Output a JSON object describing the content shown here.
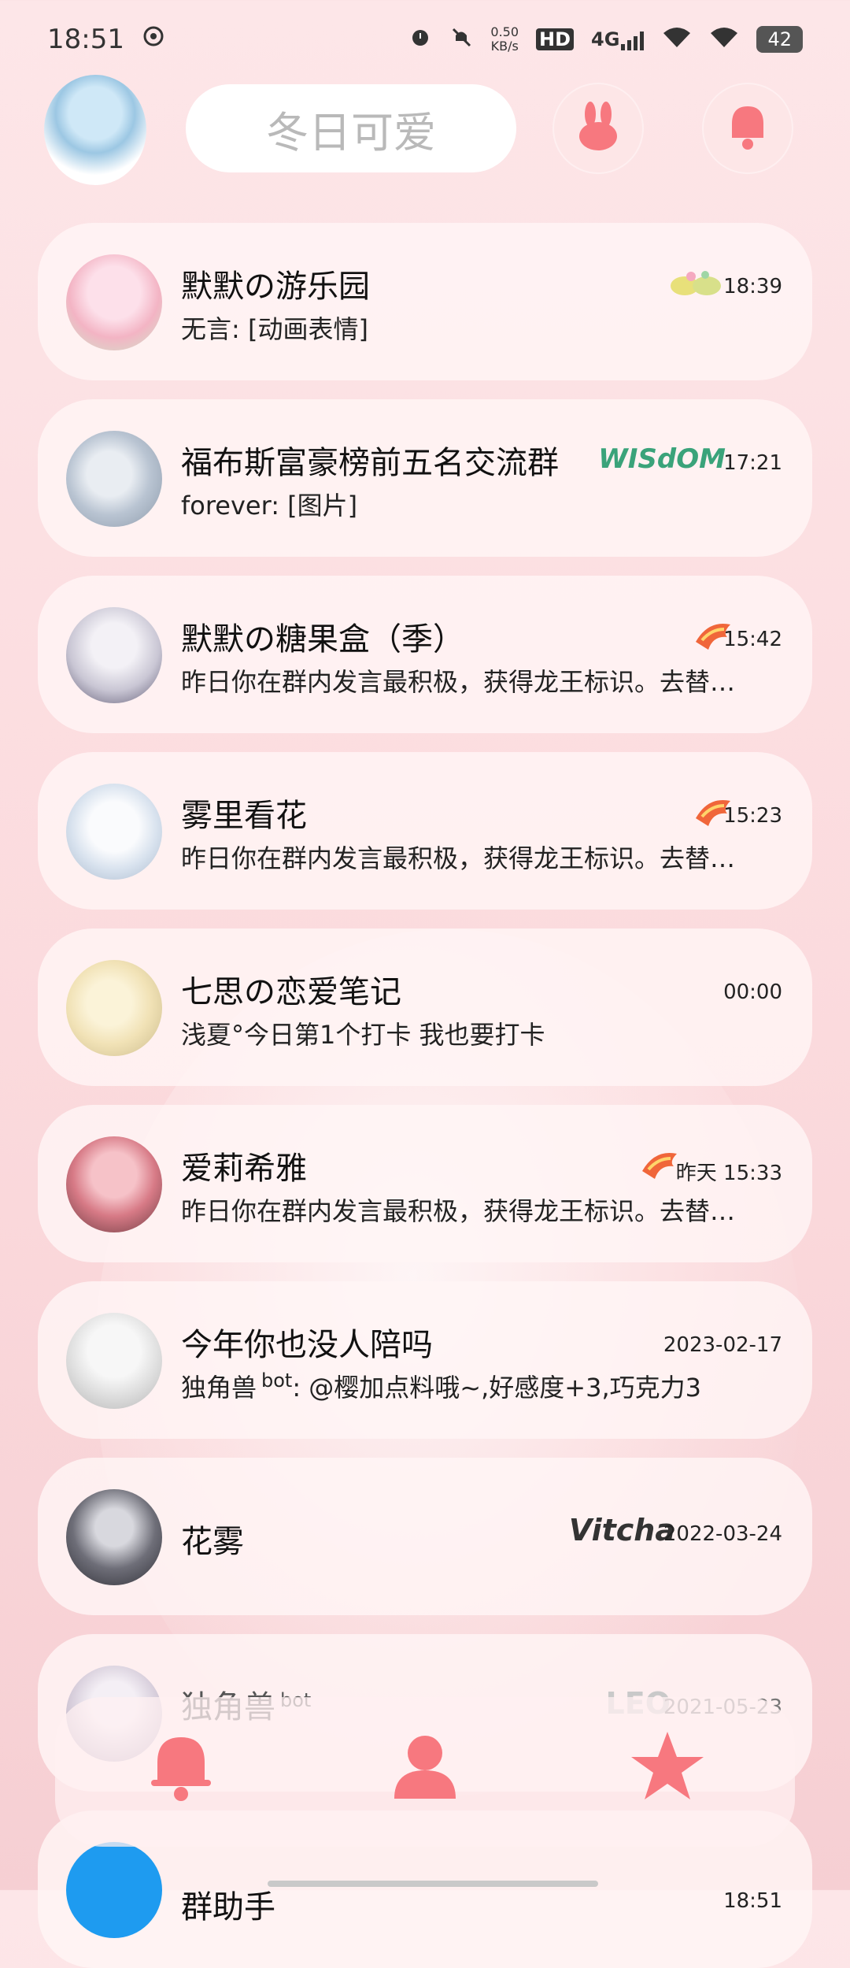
{
  "status_bar": {
    "time": "18:51",
    "net_speed_value": "0.50",
    "net_speed_unit": "KB/s",
    "hd": "HD",
    "signal_label": "4G",
    "battery": "42"
  },
  "header": {
    "search_placeholder": "冬日可爱"
  },
  "chats": [
    {
      "title": "默默の游乐园",
      "preview": "无言: [动画表情]",
      "time": "18:39",
      "badge": "🌼",
      "avatar_color": "#f3b4c4"
    },
    {
      "title": "福布斯富豪榜前五名交流群",
      "preview": "forever: [图片]",
      "time": "17:21",
      "badge": "WISdOM",
      "avatar_color": "#b9c4d2"
    },
    {
      "title": "默默の糖果盒（季）",
      "preview": "昨日你在群内发言最积极，获得龙王标识。去替…",
      "time": "15:42",
      "badge": "🐉",
      "avatar_color": "#c9c6d4"
    },
    {
      "title": "雾里看花",
      "preview": "昨日你在群内发言最积极，获得龙王标识。去替…",
      "time": "15:23",
      "badge": "🐉",
      "avatar_color": "#d8e2ee"
    },
    {
      "title": "七思の恋爱笔记",
      "preview": "浅夏°今日第1个打卡   我也要打卡",
      "time": "00:00",
      "badge": "",
      "avatar_color": "#f1e2b6"
    },
    {
      "title": "爱莉希雅",
      "preview": "昨日你在群内发言最积极，获得龙王标识。去替…",
      "time": "昨天 15:33",
      "badge": "🐉",
      "avatar_color": "#d77a86"
    },
    {
      "title": "今年你也没人陪吗",
      "preview": "独角兽",
      "preview_bot": "bot",
      "preview_rest": ": @樱加点料哦~,好感度+3,巧克力3",
      "time": "2023-02-17",
      "badge": "",
      "avatar_color": "#dedede"
    },
    {
      "title": "花雾",
      "preview": "",
      "time": "2022-03-24",
      "badge": "Vitcha",
      "avatar_color": "#6e6e78"
    },
    {
      "title": "独角兽",
      "title_bot": "bot",
      "preview": "",
      "time": "2021-05-23",
      "badge": "LEO",
      "avatar_color": "#d9d0dd"
    },
    {
      "title": "群助手",
      "preview": "",
      "time": "18:51",
      "badge": "",
      "avatar_color": "#1e9bf0"
    }
  ],
  "colors": {
    "accent": "#f7787f",
    "card_bg": "#fff5f5",
    "page_bg": "#fbdadd"
  },
  "bottom_nav": {
    "items": [
      "bell-icon",
      "contacts-icon",
      "star-icon"
    ]
  }
}
